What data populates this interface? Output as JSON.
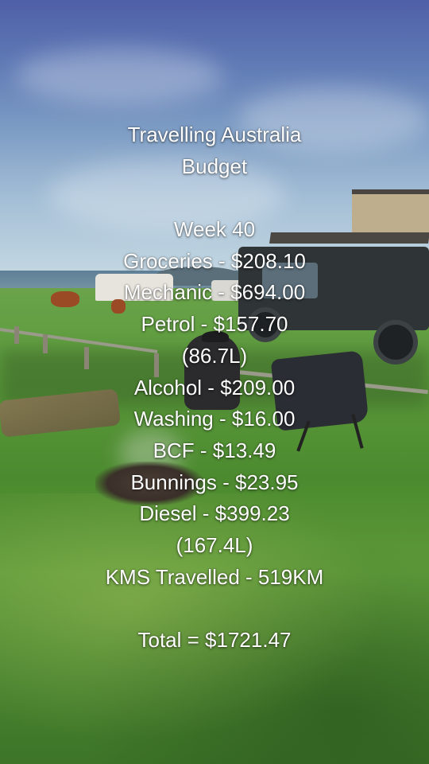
{
  "overlay": {
    "lines": [
      "Travelling Australia",
      "Budget",
      "",
      "Week 40",
      "Groceries - $208.10",
      "Mechanic - $694.00",
      "Petrol - $157.70",
      "(86.7L)",
      "Alcohol - $209.00",
      "Washing - $16.00",
      "BCF - $13.49",
      "Bunnings - $23.95",
      "Diesel - $399.23",
      "(167.4L)",
      "KMS Travelled - 519KM",
      "",
      "Total = $1721.47"
    ]
  },
  "scene": {
    "sky_color": "#5f7ab5",
    "grass_color": "#5b9a3b",
    "text_color": "#ffffff"
  }
}
